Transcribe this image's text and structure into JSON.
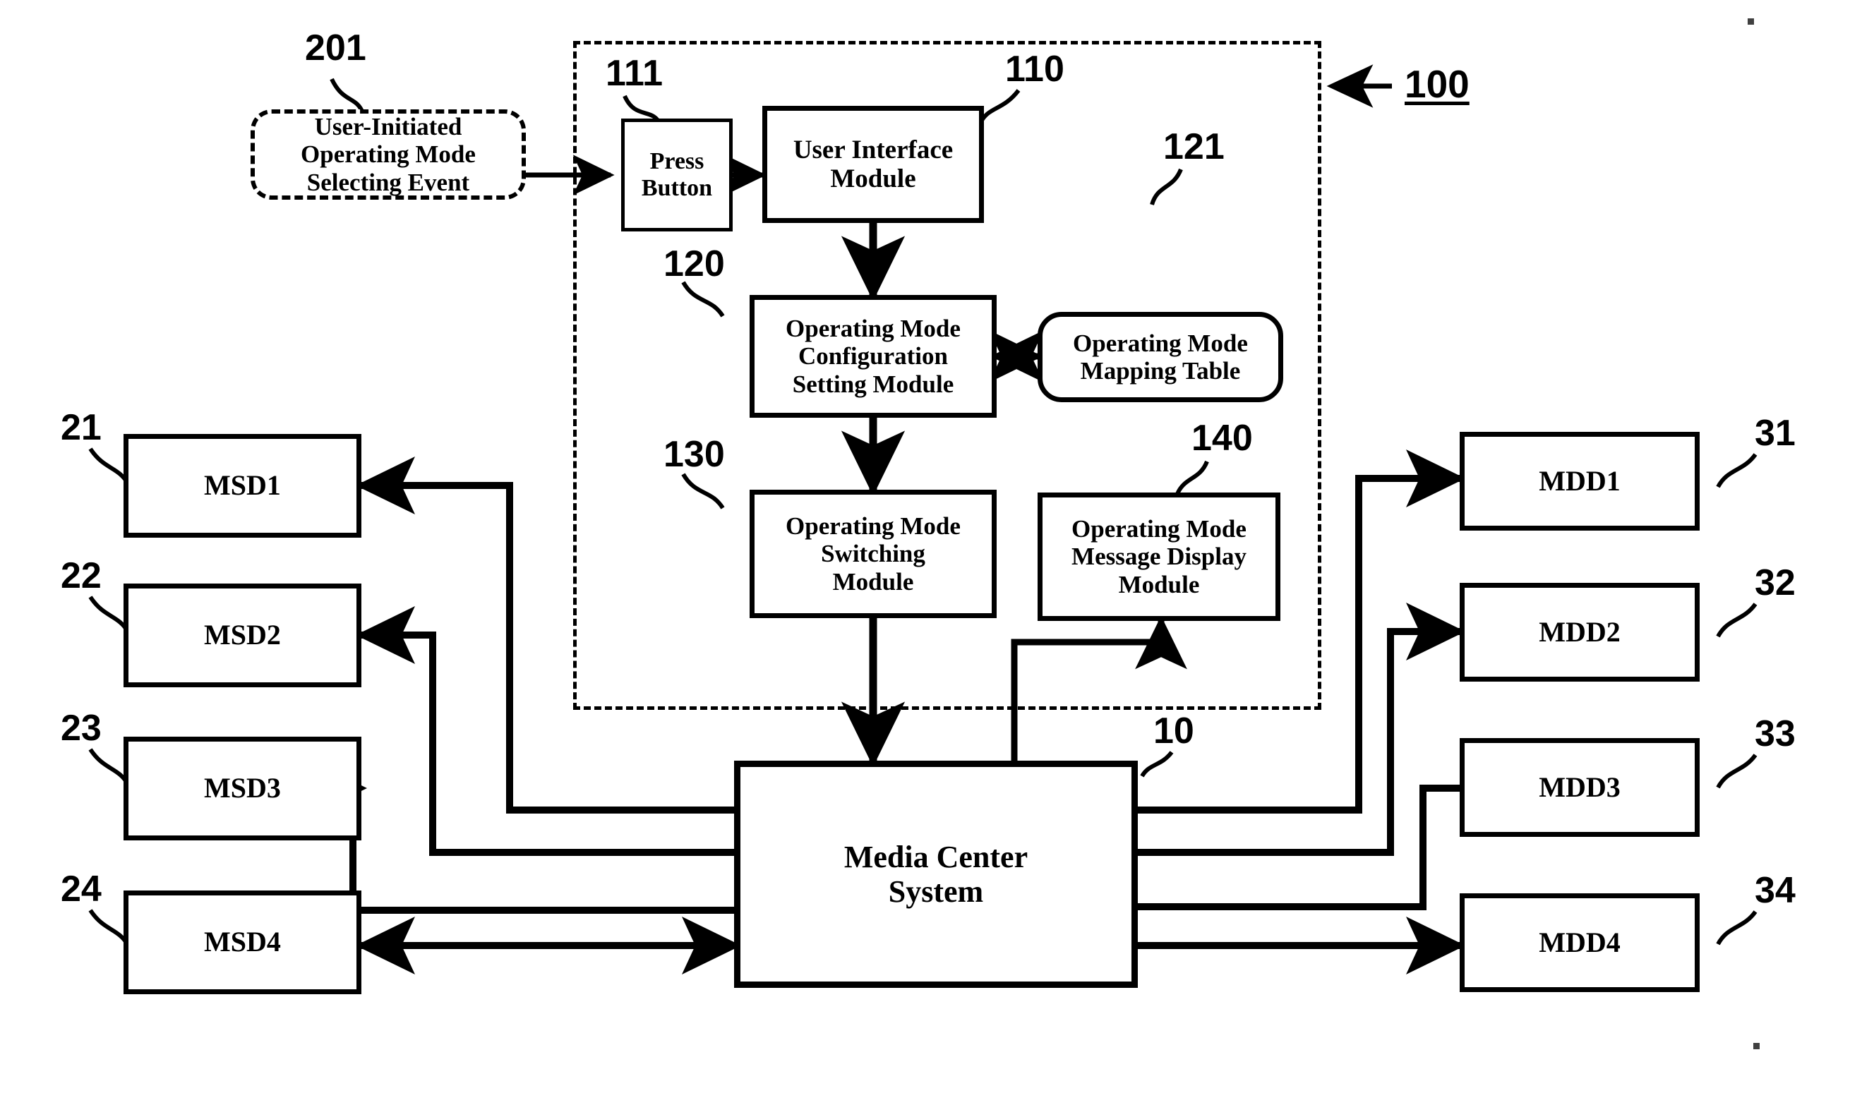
{
  "figure": {
    "system_boundary_ref": "100",
    "external_event": {
      "ref": "201",
      "label": "User-Initiated\nOperating Mode\nSelecting Event",
      "line1": "User-Initiated",
      "line2": "Operating Mode",
      "line3": "Selecting Event"
    }
  },
  "modules": {
    "press_button": {
      "ref": "111",
      "line1": "Press",
      "line2": "Button"
    },
    "user_interface": {
      "ref": "110",
      "line1": "User Interface",
      "line2": "Module"
    },
    "config_setting": {
      "ref": "120",
      "line1": "Operating Mode",
      "line2": "Configuration",
      "line3": "Setting Module"
    },
    "mapping_table": {
      "ref": "121",
      "line1": "Operating Mode",
      "line2": "Mapping Table"
    },
    "switching": {
      "ref": "130",
      "line1": "Operating Mode",
      "line2": "Switching",
      "line3": "Module"
    },
    "message_display": {
      "ref": "140",
      "line1": "Operating Mode",
      "line2": "Message Display",
      "line3": "Module"
    }
  },
  "media_center": {
    "ref": "10",
    "line1": "Media Center",
    "line2": "System"
  },
  "sources": [
    {
      "ref": "21",
      "label": "MSD1"
    },
    {
      "ref": "22",
      "label": "MSD2"
    },
    {
      "ref": "23",
      "label": "MSD3"
    },
    {
      "ref": "24",
      "label": "MSD4"
    }
  ],
  "displays": [
    {
      "ref": "31",
      "label": "MDD1"
    },
    {
      "ref": "32",
      "label": "MDD2"
    },
    {
      "ref": "33",
      "label": "MDD3"
    },
    {
      "ref": "34",
      "label": "MDD4"
    }
  ]
}
